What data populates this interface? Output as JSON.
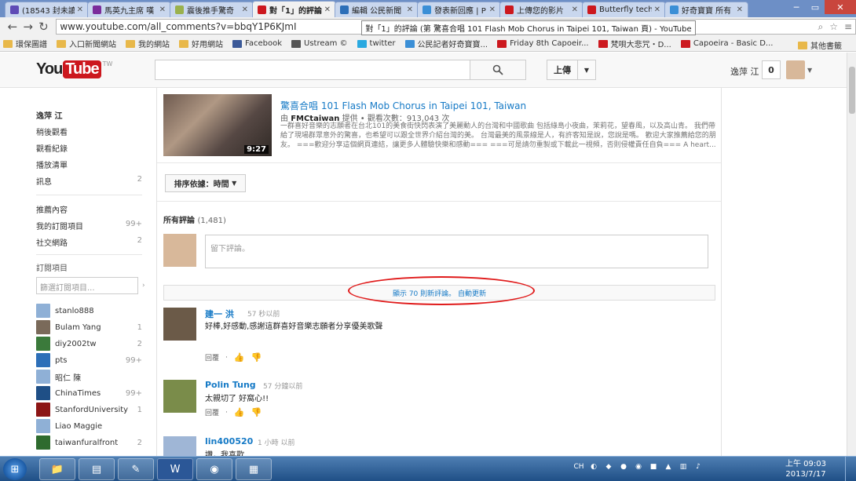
{
  "browser": {
    "tabs": [
      {
        "label": "(18543 封未讀",
        "color": "#5f4bb6"
      },
      {
        "label": "馬英九主席 嘆",
        "color": "#7b2c9b"
      },
      {
        "label": "震後推手驚奇",
        "color": "#9ab14d"
      },
      {
        "label": "對「1」的評論",
        "color": "#cc181e"
      },
      {
        "label": "編輯 公民新聞",
        "color": "#2d6fb8"
      },
      {
        "label": "發表新回應 | P",
        "color": "#3b8fd6"
      },
      {
        "label": "上傳您的影片",
        "color": "#cc181e"
      },
      {
        "label": "Butterfly techn",
        "color": "#cc181e"
      },
      {
        "label": "好奇寶寶 所有",
        "color": "#3b8fd6"
      }
    ],
    "url": "www.youtube.com/all_comments?v=bbqY1P6KJmI",
    "tooltip": "對「1」的評論 (第 驚喜合唱 101 Flash Mob Chorus in Taipei 101, Taiwan 頁) - YouTube",
    "bookmarks": [
      {
        "label": "環保圖譜",
        "color": "#e8b84a"
      },
      {
        "label": "入口新聞網站",
        "color": "#e8b84a"
      },
      {
        "label": "我的網站",
        "color": "#e8b84a"
      },
      {
        "label": "好用網站",
        "color": "#e8b84a"
      },
      {
        "label": "Facebook",
        "color": "#3b5998"
      },
      {
        "label": "Ustream ©",
        "color": "#555555"
      },
      {
        "label": "twitter",
        "color": "#2aa9e0"
      },
      {
        "label": "公民記者好奇寶寶...",
        "color": "#3b8fd6"
      },
      {
        "label": "Friday 8th Capoeir...",
        "color": "#cc181e"
      },
      {
        "label": "梵唄大悲咒・D...",
        "color": "#cc181e"
      },
      {
        "label": "Capoeira - Basic D...",
        "color": "#cc181e"
      }
    ],
    "other_bookmarks": "其他書籤"
  },
  "header": {
    "logo_you": "You",
    "logo_tube": "Tube",
    "logo_region": "TW",
    "upload_label": "上傳",
    "user_name": "逸萍 江",
    "notification_count": "0"
  },
  "guide": {
    "top_items": [
      {
        "label": "逸萍 江",
        "count": ""
      },
      {
        "label": "稍後觀看",
        "count": ""
      },
      {
        "label": "觀看紀錄",
        "count": ""
      },
      {
        "label": "播放清單",
        "count": ""
      },
      {
        "label": "訊息",
        "count": "2"
      }
    ],
    "mid_items": [
      {
        "label": "推薦內容",
        "count": ""
      },
      {
        "label": "我的訂閱項目",
        "count": "99+"
      },
      {
        "label": "社交網路",
        "count": "2"
      }
    ],
    "subscriptions_heading": "訂閱項目",
    "search_placeholder": "篩選訂閱項目...",
    "subscriptions": [
      {
        "name": "stanlo888",
        "count": "",
        "color": "#8fb0d6"
      },
      {
        "name": "Bulam Yang",
        "count": "1",
        "color": "#7a6a5a"
      },
      {
        "name": "diy2002tw",
        "count": "2",
        "color": "#3b7a3b"
      },
      {
        "name": "pts",
        "count": "99+",
        "color": "#2d6fb8"
      },
      {
        "name": "昭仁 陳",
        "count": "",
        "color": "#8fb0d6"
      },
      {
        "name": "ChinaTimes",
        "count": "99+",
        "color": "#1f4f86"
      },
      {
        "name": "StanfordUniversity",
        "count": "1",
        "color": "#8c1515"
      },
      {
        "name": "Liao Maggie",
        "count": "",
        "color": "#8fb0d6"
      },
      {
        "name": "taiwanfuralfront",
        "count": "2",
        "color": "#2e6b2e"
      }
    ]
  },
  "video": {
    "title": "驚喜合唱 101 Flash Mob Chorus in Taipei 101, Taiwan",
    "provider_prefix": "由",
    "provider": "FMCtaiwan",
    "meta_suffix": "提供 • 觀看次數：913,043 次",
    "duration": "9:27",
    "description": "一群喜好音樂的志願者在台北101的美食街快閃表演了美麗動人的台灣和中國歌曲 包括綠島小夜曲，茉莉花，望春風，以及高山青。 我們帶給了現場群眾意外的驚喜，也希望可以跟全世界介紹台灣的美。 台灣最美的風景線是人，有許客知是說，您說是嗎。 歡迎大家推薦給您的朋友。 ===歡迎分享這個網頁連結，讓更多人體驗快樂和感動=== ===可是請勿重製或下載此一視頻，否則侵權責任自負=== A heart..."
  },
  "comments_section": {
    "sort_label": "排序依據：時間",
    "all_comments_label": "所有評論",
    "all_comments_count": "(1,481)",
    "input_placeholder": "留下評論。",
    "new_comments_label": "顯示 70 則新評論。 自動更新",
    "reply_label": "回覆",
    "comments": [
      {
        "author": "建一 洪",
        "time": "57 秒以前",
        "text": "好棒,好感動,感謝這群喜好音樂志願者分享優美歌聲",
        "avatar_color": "#6b5a48"
      },
      {
        "author": "Polin Tung",
        "time": "57 分鐘以前",
        "text": "太親切了 好窩心!!",
        "avatar_color": "#7a8c4a"
      },
      {
        "author": "lin400520",
        "time": "1 小時 以前",
        "text": "讚，我喜歡",
        "avatar_color": "#9fb6d6"
      }
    ]
  },
  "taskbar": {
    "apps": [
      "folder-icon",
      "archive-icon",
      "paint-icon",
      "word-icon",
      "chrome-icon",
      "notepad-icon"
    ],
    "lang": "CH",
    "time": "上午 09:03",
    "date": "2013/7/17"
  }
}
